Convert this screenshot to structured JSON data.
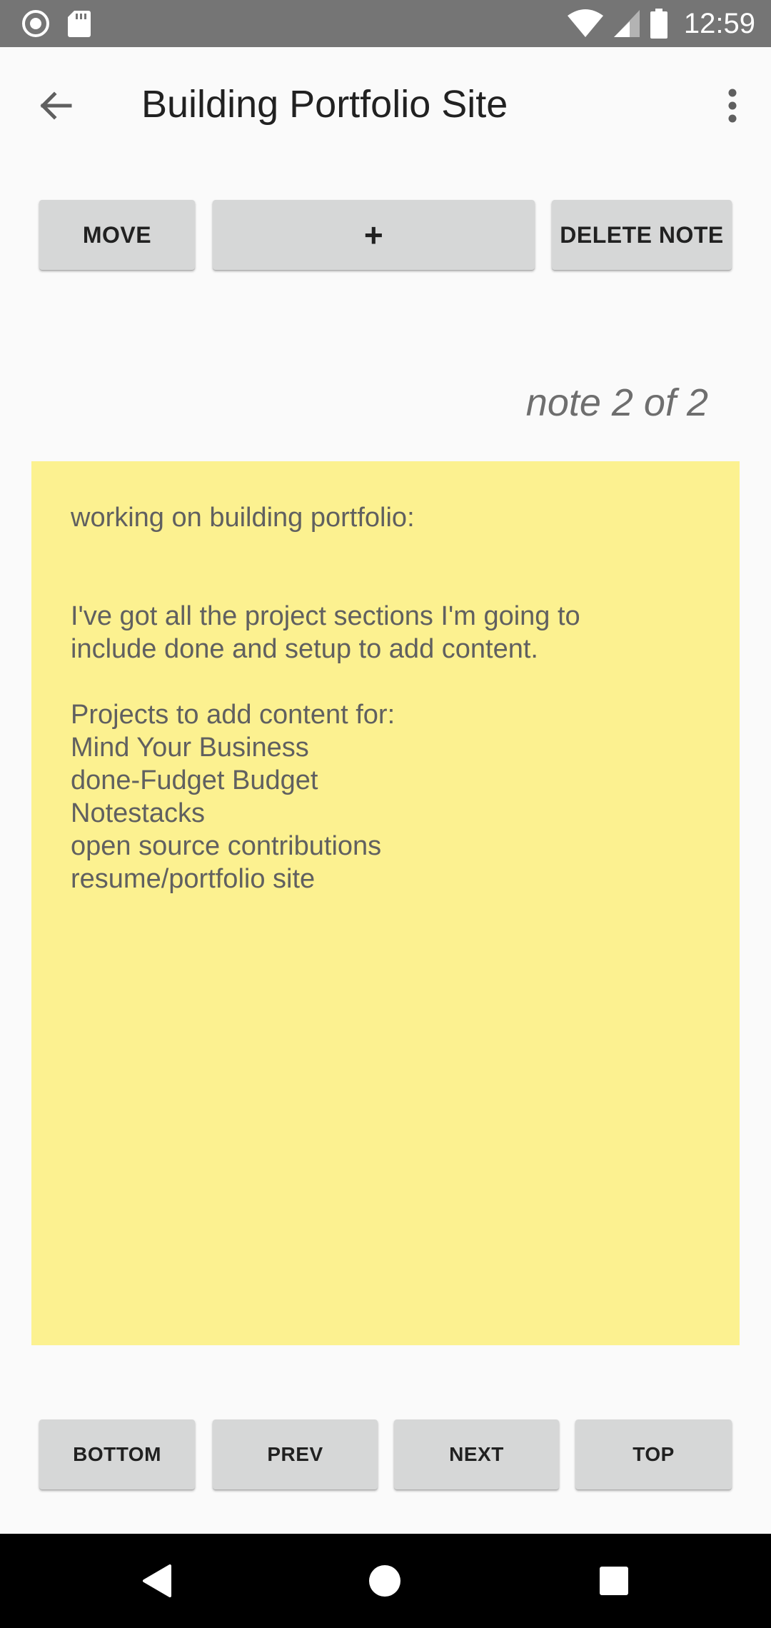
{
  "status_bar": {
    "time": "12:59",
    "icons": [
      "record-icon",
      "sd-card-icon",
      "wifi-icon",
      "cellular-signal-icon",
      "battery-icon"
    ]
  },
  "app_bar": {
    "title": "Building Portfolio Site",
    "icons": [
      "back-arrow-icon",
      "more-vert-icon"
    ]
  },
  "toolbar": {
    "move_label": "MOVE",
    "add_label": "+",
    "delete_label": "DELETE NOTE"
  },
  "note": {
    "counter": "note 2 of 2",
    "body": "working on building portfolio:\n\n\nI've got all the project sections I'm going to\ninclude done and setup to add content.\n\nProjects to add content for:\nMind Your Business\ndone-Fudget Budget\nNotestacks\nopen source contributions\nresume/portfolio site",
    "background_color": "#fcf190"
  },
  "navigation_buttons": {
    "bottom_label": "BOTTOM",
    "prev_label": "PREV",
    "next_label": "NEXT",
    "top_label": "TOP"
  },
  "system_nav": {
    "icons": [
      "back-triangle-icon",
      "home-circle-icon",
      "recents-square-icon"
    ]
  },
  "colors": {
    "status_bar": "#757575",
    "background": "#fafafa",
    "button": "#d6d7d7",
    "note": "#fcf190",
    "nav_bar": "#000000"
  }
}
